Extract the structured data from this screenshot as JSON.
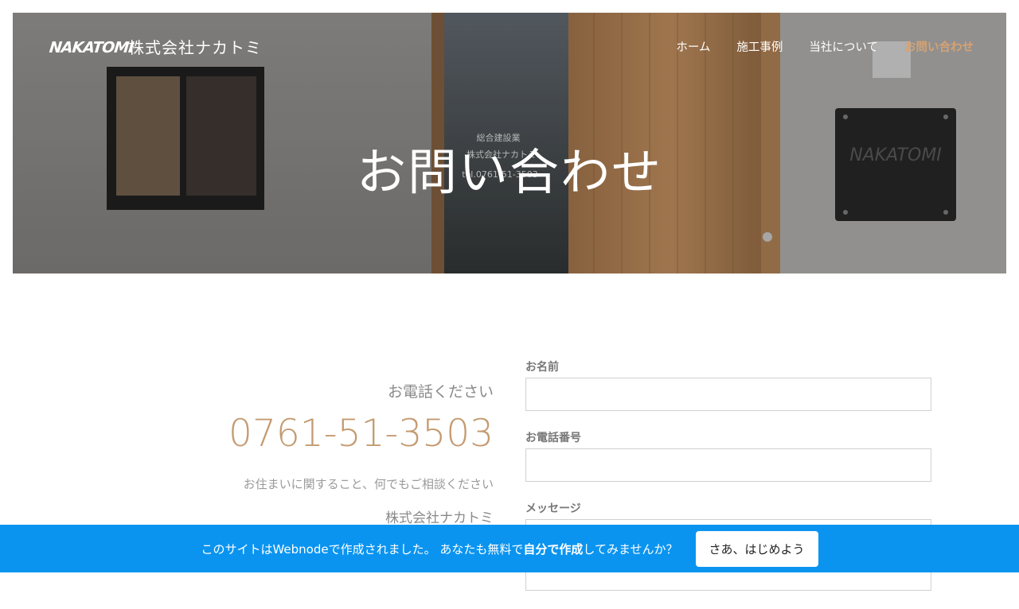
{
  "header": {
    "logo_text": "NAKATOMI",
    "company_name": "株式会社ナカトミ",
    "nav": [
      {
        "label": "ホーム"
      },
      {
        "label": "施工事例"
      },
      {
        "label": "当社について"
      },
      {
        "label": "お問い合わせ",
        "active": true
      }
    ]
  },
  "hero": {
    "title": "お問い合わせ",
    "photo_sign_lines": [
      "総合建設業",
      "株式会社ナカトミ",
      "tel.0761-51-3503"
    ],
    "photo_plate_text": "NAKATOMI"
  },
  "contact": {
    "call_heading": "お電話ください",
    "phone": "0761-51-3503",
    "tagline": "お住まいに関すること、何でもご相談ください",
    "company": "株式会社ナカトミ"
  },
  "form": {
    "name_label": "お名前",
    "phone_label": "お電話番号",
    "message_label": "メッセージ",
    "name_value": "",
    "phone_value": "",
    "message_value": ""
  },
  "webnode_bar": {
    "text_prefix": "このサイトはWebnodeで作成されました。 あなたも無料で",
    "text_bold": "自分で作成",
    "text_suffix": "してみませんか？",
    "button_label": "さあ、はじめよう"
  },
  "colors": {
    "accent": "#c49a70",
    "nav_active": "#d6a273",
    "bar_blue": "#0a94f0"
  }
}
